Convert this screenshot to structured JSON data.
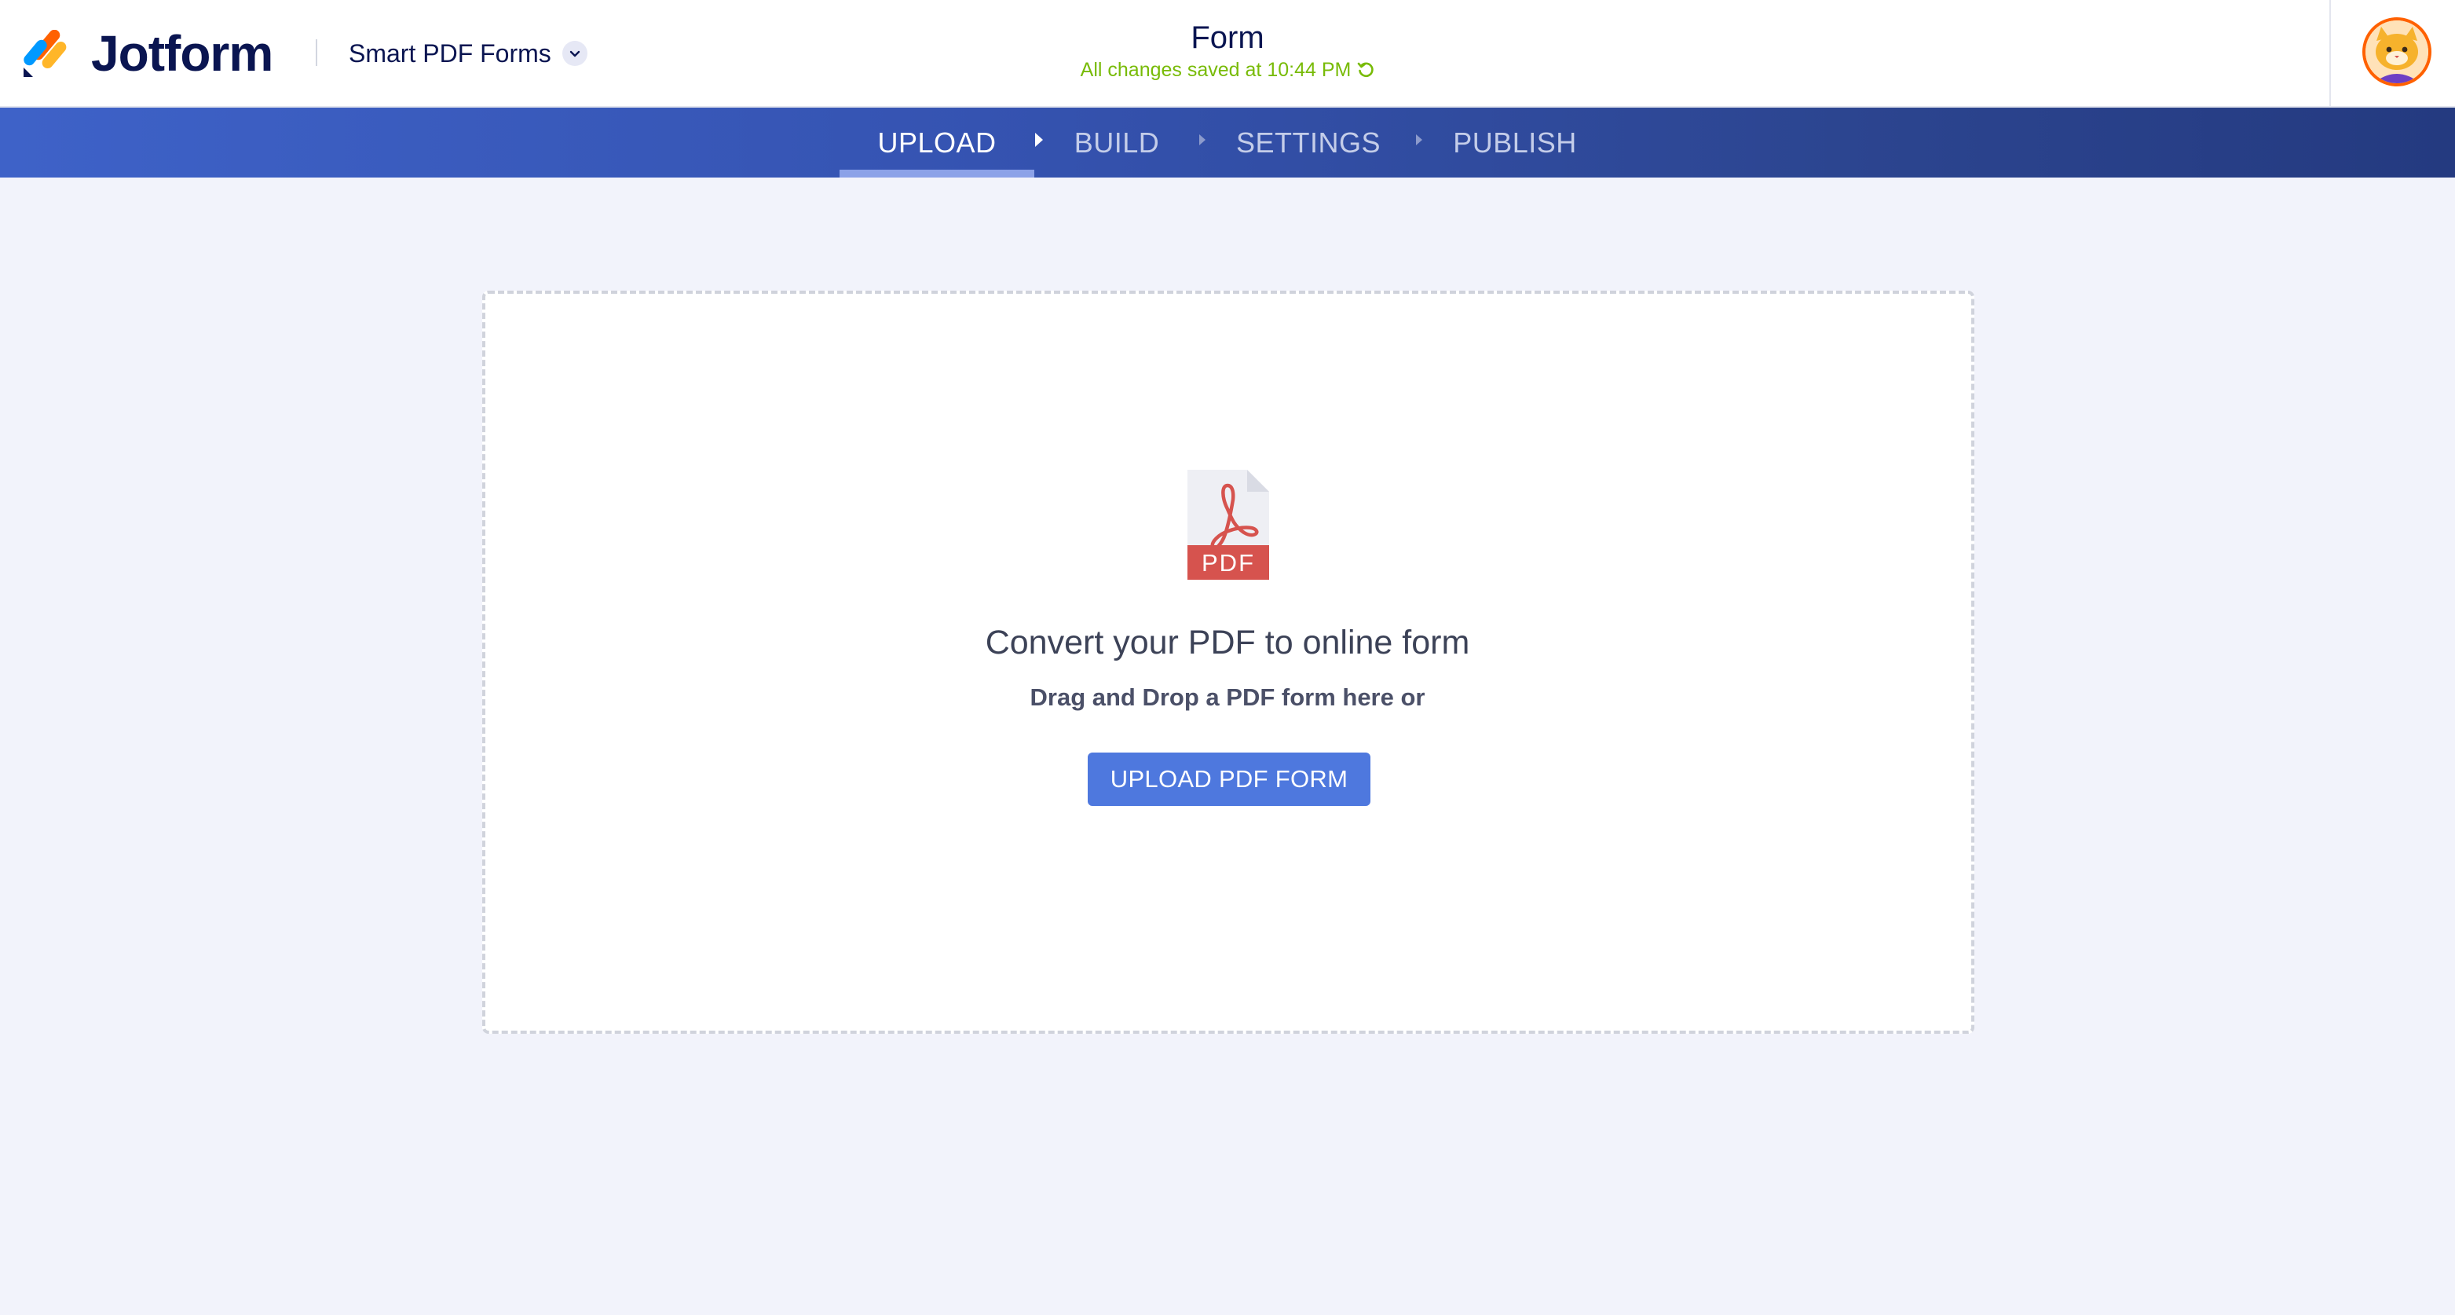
{
  "header": {
    "logo_text": "Jotform",
    "product_name": "Smart PDF Forms",
    "form_title": "Form",
    "save_status": "All changes saved at 10:44 PM"
  },
  "steps": [
    {
      "label": "UPLOAD",
      "active": true
    },
    {
      "label": "BUILD",
      "active": false
    },
    {
      "label": "SETTINGS",
      "active": false
    },
    {
      "label": "PUBLISH",
      "active": false
    }
  ],
  "upload": {
    "pdf_icon_label": "PDF",
    "headline": "Convert your PDF to online form",
    "subline": "Drag and Drop a PDF form here or",
    "button_label": "UPLOAD PDF FORM"
  },
  "colors": {
    "brand_navy": "#0a1551",
    "saved_green": "#78bb07",
    "nav_start": "#3e62c8",
    "nav_end": "#243a80",
    "button_blue": "#4e78de",
    "pdf_red": "#d6534e",
    "avatar_ring": "#ff6100"
  },
  "icons": {
    "logo": "jotform-logo-icon",
    "product_dropdown": "chevron-down-icon",
    "refresh": "refresh-icon",
    "step_separator": "caret-right-icon",
    "file": "pdf-file-icon",
    "avatar": "user-avatar"
  }
}
